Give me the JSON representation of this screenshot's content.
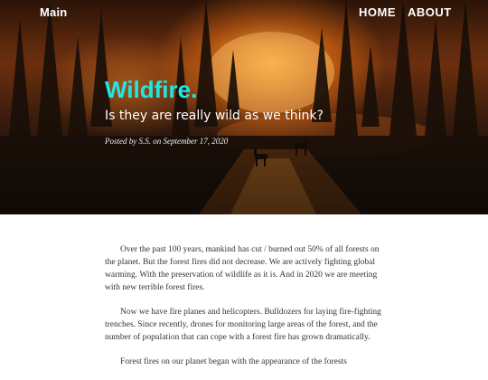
{
  "nav": {
    "brand": "Main",
    "home": "HOME",
    "about": "ABOUT"
  },
  "post": {
    "title": "Wildfire.",
    "subtitle": "Is they are really wild as we think?",
    "meta": "Posted by S.S. on September 17, 2020"
  },
  "article": {
    "paragraphs": [
      "Over the past 100 years, mankind has cut / burned out 50% of all forests on the planet. But the forest fires did not decrease. We are actively fighting global warming. With the preservation of wildlife as it is. And in 2020 we are meeting with new terrible forest fires.",
      "Now we have fire planes and helicopters. Bulldozers for laying fire-fighting trenches. Since recently, drones for monitoring large areas of the forest, and the number of population that can cope with a forest fire has grown dramatically.",
      "Forest fires on our planet began with the appearance of the forests"
    ]
  },
  "colors": {
    "title_accent": "#1ee7e7",
    "fire_glow": "#f0a040",
    "body_text": "#333333"
  }
}
